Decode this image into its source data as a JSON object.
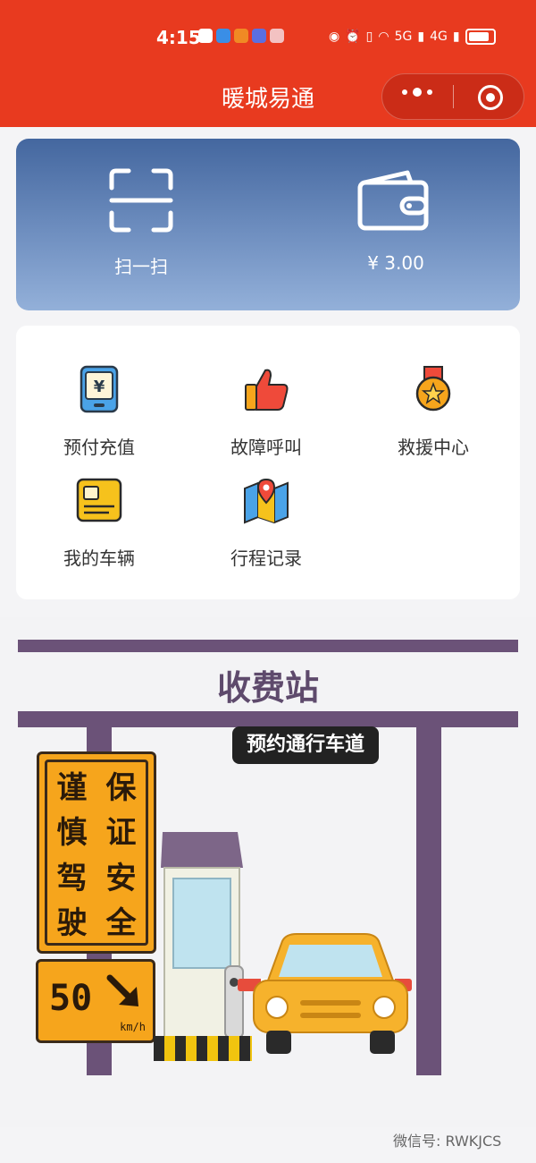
{
  "status_bar": {
    "time": "4:15",
    "network": "5G",
    "network2": "4G"
  },
  "header": {
    "title": "暖城易通"
  },
  "top_card": {
    "scan_label": "扫一扫",
    "balance": "¥ 3.00"
  },
  "services": [
    {
      "label": "预付充值",
      "icon": "prepaid-card-icon"
    },
    {
      "label": "故障呼叫",
      "icon": "thumbs-up-icon"
    },
    {
      "label": "救援中心",
      "icon": "medal-icon"
    },
    {
      "label": "我的车辆",
      "icon": "vehicle-card-icon"
    },
    {
      "label": "行程记录",
      "icon": "map-pin-icon"
    }
  ],
  "banner": {
    "title": "收费站",
    "lane_label": "预约通行车道",
    "sign_chars": [
      "谨",
      "保",
      "慎",
      "证",
      "驾",
      "安",
      "驶",
      "全"
    ],
    "speed": "50",
    "speed_unit": "km/h"
  },
  "footer": {
    "watermark": "微信号: RWKJCS"
  },
  "colors": {
    "brand_red": "#e83a1f",
    "card_blue": "#5a7bb0",
    "sign_orange": "#f6a51c",
    "toll_purple": "#6b5278"
  }
}
